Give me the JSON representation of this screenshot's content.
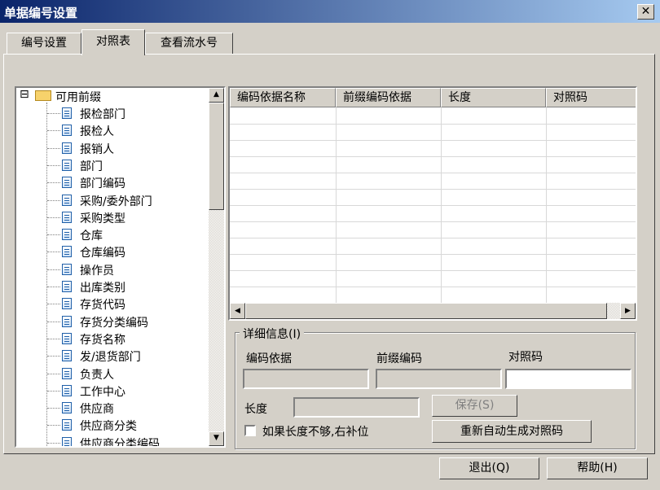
{
  "window": {
    "title": "单据编号设置",
    "close_symbol": "✕"
  },
  "tabs": [
    {
      "label": "编号设置",
      "active": false
    },
    {
      "label": "对照表",
      "active": true
    },
    {
      "label": "查看流水号",
      "active": false
    }
  ],
  "tree": {
    "root_label": "可用前缀",
    "expand_symbol": "⊟",
    "items": [
      "报检部门",
      "报检人",
      "报销人",
      "部门",
      "部门编码",
      "采购/委外部门",
      "采购类型",
      "仓库",
      "仓库编码",
      "操作员",
      "出库类别",
      "存货代码",
      "存货分类编码",
      "存货名称",
      "发/退货部门",
      "负责人",
      "工作中心",
      "供应商",
      "供应商分类",
      "供应商分类编码"
    ]
  },
  "grid": {
    "columns": [
      "编码依据名称",
      "前缀编码依据",
      "长度",
      "对照码"
    ],
    "scroll_left_symbol": "◀",
    "scroll_right_symbol": "▶"
  },
  "detail": {
    "legend": "详细信息(I)",
    "basis_label": "编码依据",
    "prefix_label": "前缀编码",
    "code_label": "对照码",
    "length_label": "长度",
    "save_label": "保存(S)",
    "checkbox_label": "如果长度不够,右补位",
    "regenerate_label": "重新自动生成对照码"
  },
  "footer": {
    "exit_label": "退出(Q)",
    "help_label": "帮助(H)"
  }
}
